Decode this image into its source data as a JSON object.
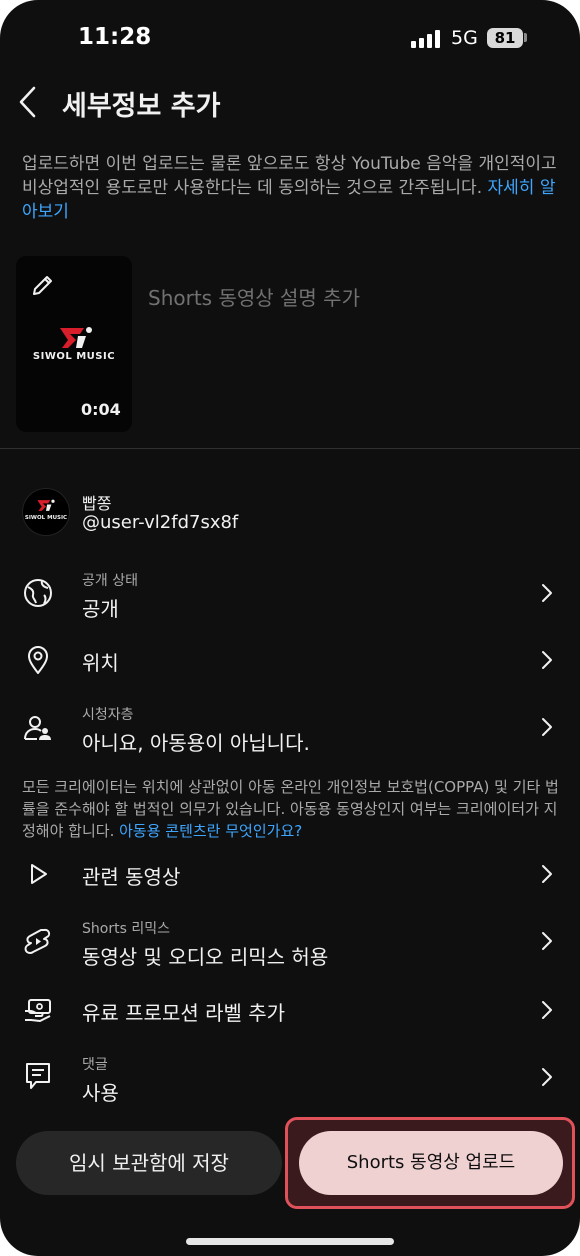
{
  "status_bar": {
    "time": "11:28",
    "network": "5G",
    "battery": "81"
  },
  "header": {
    "title": "세부정보 추가"
  },
  "notice": {
    "text": "업로드하면 이번 업로드는 물론 앞으로도 항상 YouTube 음악을 개인적이고 비상업적인 용도로만 사용한다는 데 동의하는 것으로 간주됩니다. ",
    "link": "자세히 알아보기"
  },
  "video": {
    "brand": "SIWOL MUSIC",
    "duration": "0:04",
    "description_placeholder": "Shorts 동영상 설명 추가"
  },
  "channel": {
    "name": "빱쫑",
    "handle": "@user-vl2fd7sx8f",
    "brand": "SIWOL MUSIC"
  },
  "settings": {
    "visibility": {
      "label": "공개 상태",
      "value": "공개"
    },
    "location": {
      "value": "위치"
    },
    "audience": {
      "label": "시청자층",
      "value": "아니요, 아동용이 아닙니다."
    },
    "related": {
      "value": "관련 동영상"
    },
    "remix": {
      "label": "Shorts 리믹스",
      "value": "동영상 및 오디오 리믹스 허용"
    },
    "paid_promo": {
      "value": "유료 프로모션 라벨 추가"
    },
    "comments": {
      "label": "댓글",
      "value": "사용"
    }
  },
  "coppa": {
    "text": "모든 크리에이터는 위치에 상관없이 아동 온라인 개인정보 보호법(COPPA) 및 기타 법률을 준수해야 할 법적인 의무가 있습니다. 아동용 동영상인지 여부는 크리에이터가 지정해야 합니다. ",
    "link": "아동용 콘텐츠란 무엇인가요?"
  },
  "buttons": {
    "save_draft": "임시 보관함에 저장",
    "upload": "Shorts 동영상 업로드"
  },
  "colors": {
    "background": "#0f0f0f",
    "link": "#3ea6ff",
    "upload_button": "#f0d1d2",
    "highlight": "#e0525a"
  }
}
